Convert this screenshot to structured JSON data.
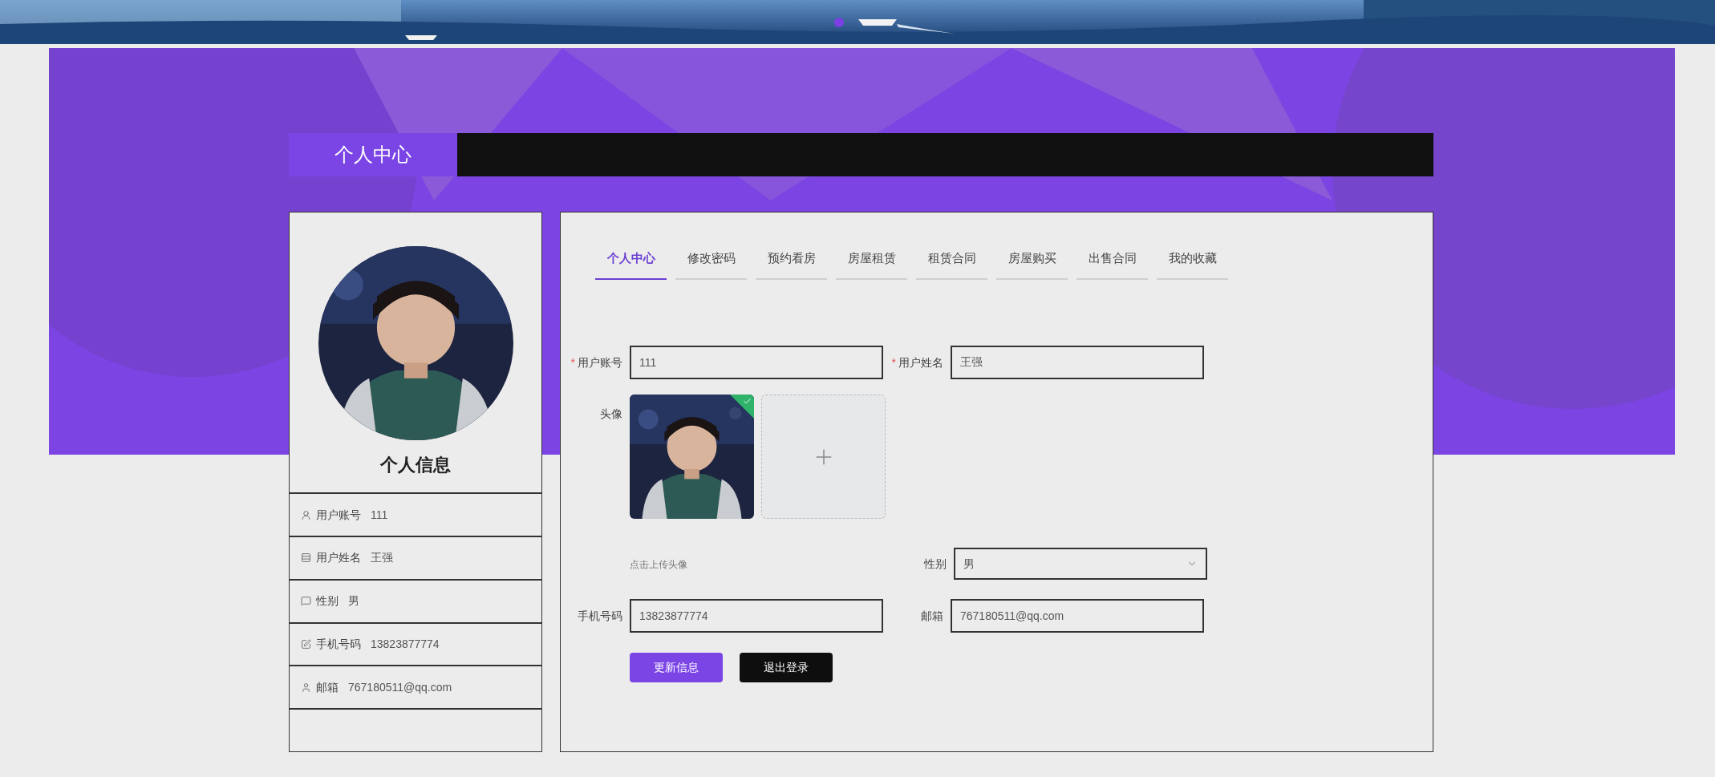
{
  "carousel": {
    "dots": [
      {
        "selected": true
      }
    ]
  },
  "header": {
    "title": "个人中心"
  },
  "profile": {
    "heading": "个人信息",
    "items": [
      {
        "kind": "account",
        "label": "用户账号",
        "value": "111"
      },
      {
        "kind": "name",
        "label": "用户姓名",
        "value": "王强"
      },
      {
        "kind": "gender",
        "label": "性别",
        "value": "男"
      },
      {
        "kind": "phone",
        "label": "手机号码",
        "value": "13823877774"
      },
      {
        "kind": "email",
        "label": "邮箱",
        "value": "767180511@qq.com"
      }
    ]
  },
  "tabs": [
    {
      "label": "个人中心",
      "selected": true
    },
    {
      "label": "修改密码",
      "selected": false
    },
    {
      "label": "预约看房",
      "selected": false
    },
    {
      "label": "房屋租赁",
      "selected": false
    },
    {
      "label": "租赁合同",
      "selected": false
    },
    {
      "label": "房屋购买",
      "selected": false
    },
    {
      "label": "出售合同",
      "selected": false
    },
    {
      "label": "我的收藏",
      "selected": false
    }
  ],
  "form": {
    "account": {
      "mark": "*",
      "label": "用户账号",
      "value": "111"
    },
    "name": {
      "mark": "*",
      "label": "用户姓名",
      "value": "王强"
    },
    "avatar": {
      "label": "头像",
      "uploaded": true,
      "hint": "点击上传头像"
    },
    "gender": {
      "label": "性别",
      "value": "男"
    },
    "phone": {
      "label": "手机号码",
      "value": "13823877774"
    },
    "email": {
      "label": "邮箱",
      "value": "767180511@qq.com"
    },
    "buttons": [
      {
        "label": "更新信息",
        "kind": "primary"
      },
      {
        "label": "退出登录",
        "kind": "dark"
      }
    ]
  }
}
